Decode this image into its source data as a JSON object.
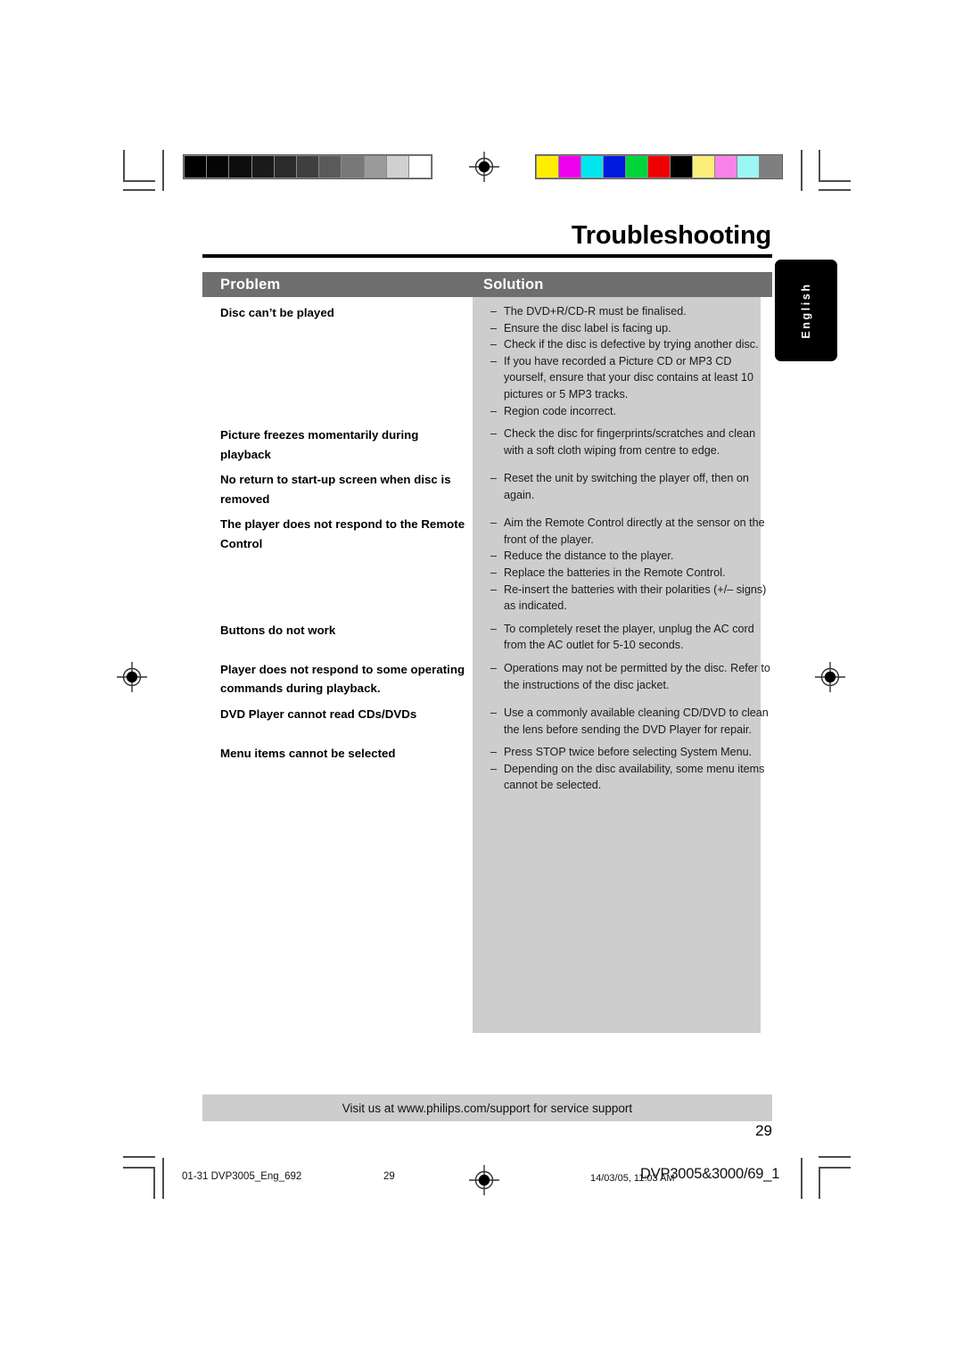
{
  "document": {
    "title": "Troubleshooting",
    "page_number": "29",
    "language_tab": "English"
  },
  "table": {
    "headers": {
      "problem": "Problem",
      "solution": "Solution"
    },
    "dash": "–",
    "rows": [
      {
        "problem": "Disc can’t be played",
        "solutions": [
          "The DVD+R/CD-R must be finalised.",
          "Ensure the disc label is facing up.",
          "Check if the disc is defective by trying another disc.",
          "If you have recorded a Picture CD or MP3 CD yourself, ensure that your disc contains at least 10 pictures or 5 MP3 tracks.",
          "Region code incorrect."
        ]
      },
      {
        "problem": "Picture freezes momentarily during playback",
        "solutions": [
          "Check the disc for fingerprints/scratches and clean with a soft cloth wiping from centre to edge."
        ]
      },
      {
        "problem": "No return to start-up screen when disc is removed",
        "solutions": [
          "Reset the unit by switching the player off, then on again."
        ]
      },
      {
        "problem": "The player does not respond to the Remote Control",
        "solutions": [
          "Aim the Remote Control directly at the sensor on the front of the player.",
          "Reduce the distance to the player.",
          "Replace the batteries in the Remote Control.",
          "Re-insert the batteries with their polarities (+/– signs) as indicated."
        ]
      },
      {
        "problem": "Buttons do not work",
        "solutions": [
          "To completely reset the player, unplug the AC cord from the AC outlet for 5-10 seconds."
        ]
      },
      {
        "problem": "Player does not respond to some operating commands during playback.",
        "solutions": [
          "Operations may not be permitted by the disc. Refer to the instructions of  the disc jacket."
        ]
      },
      {
        "problem": "DVD Player cannot read CDs/DVDs",
        "solutions": [
          "Use a commonly available cleaning CD/DVD to clean the lens before sending the DVD Player for repair."
        ]
      },
      {
        "problem": "Menu items cannot be selected",
        "solutions": [
          "Press STOP twice before selecting System Menu.",
          "Depending on the disc availability, some menu items cannot be selected."
        ]
      }
    ]
  },
  "support_bar": {
    "text": "Visit us at www.philips.com/support for service support"
  },
  "print_footer": {
    "left": "01-31 DVP3005_Eng_692",
    "page": "29",
    "timestamp": "14/03/05, 11:03 AM",
    "doc_id": "DVP3005&3000/69_1"
  },
  "calibration": {
    "grayscale": [
      "#000000",
      "#050505",
      "#0d0d0d",
      "#1a1a1a",
      "#2b2b2b",
      "#3f3f3f",
      "#5a5a5a",
      "#787878",
      "#9a9a9a",
      "#d0d0d0",
      "#ffffff"
    ],
    "color": [
      "#ffee00",
      "#ee00ee",
      "#00e5ee",
      "#0019e0",
      "#00d53b",
      "#ee0000",
      "#000000",
      "#fbef7a",
      "#f982e8",
      "#9df6f6",
      "#7f7f7f"
    ]
  },
  "colors": {
    "header_gray": "#6e6e6e",
    "panel_gray": "#cdcdcd",
    "rule_black": "#000000"
  }
}
